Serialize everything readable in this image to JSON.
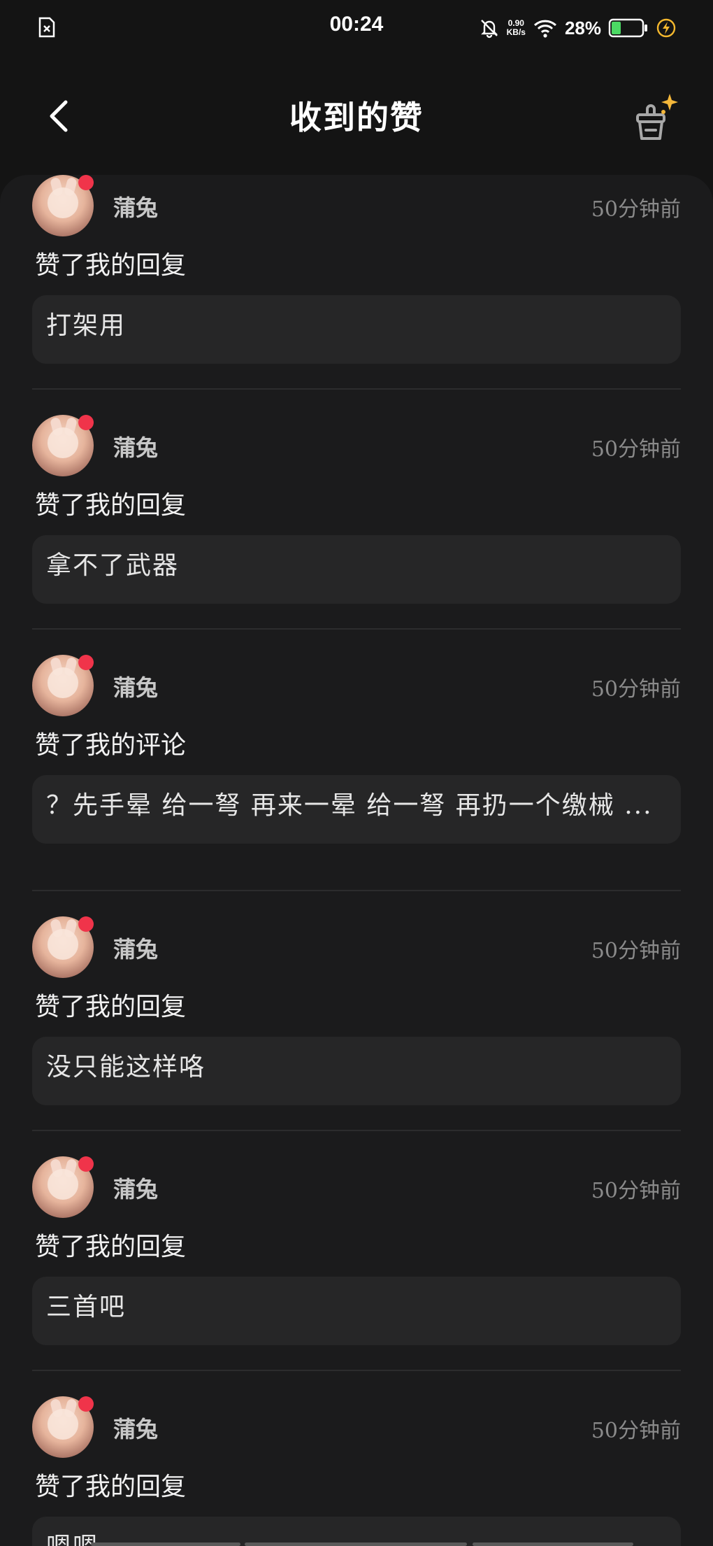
{
  "status_bar": {
    "time": "00:24",
    "net_speed_value": "0.90",
    "net_speed_unit": "KB/s",
    "battery_percent": "28%"
  },
  "header": {
    "title": "收到的赞"
  },
  "items": [
    {
      "username": "蒲兔",
      "time": "50分钟前",
      "action": "赞了我的回复",
      "content": "打架用"
    },
    {
      "username": "蒲兔",
      "time": "50分钟前",
      "action": "赞了我的回复",
      "content": "拿不了武器"
    },
    {
      "username": "蒲兔",
      "time": "50分钟前",
      "action": "赞了我的评论",
      "content": "？先手晕 给一弩 再来一晕 给一弩 再扔一个缴械 ..."
    },
    {
      "username": "蒲兔",
      "time": "50分钟前",
      "action": "赞了我的回复",
      "content": "没只能这样咯"
    },
    {
      "username": "蒲兔",
      "time": "50分钟前",
      "action": "赞了我的回复",
      "content": "三首吧"
    },
    {
      "username": "蒲兔",
      "time": "50分钟前",
      "action": "赞了我的回复",
      "content": "嗯嗯"
    }
  ]
}
